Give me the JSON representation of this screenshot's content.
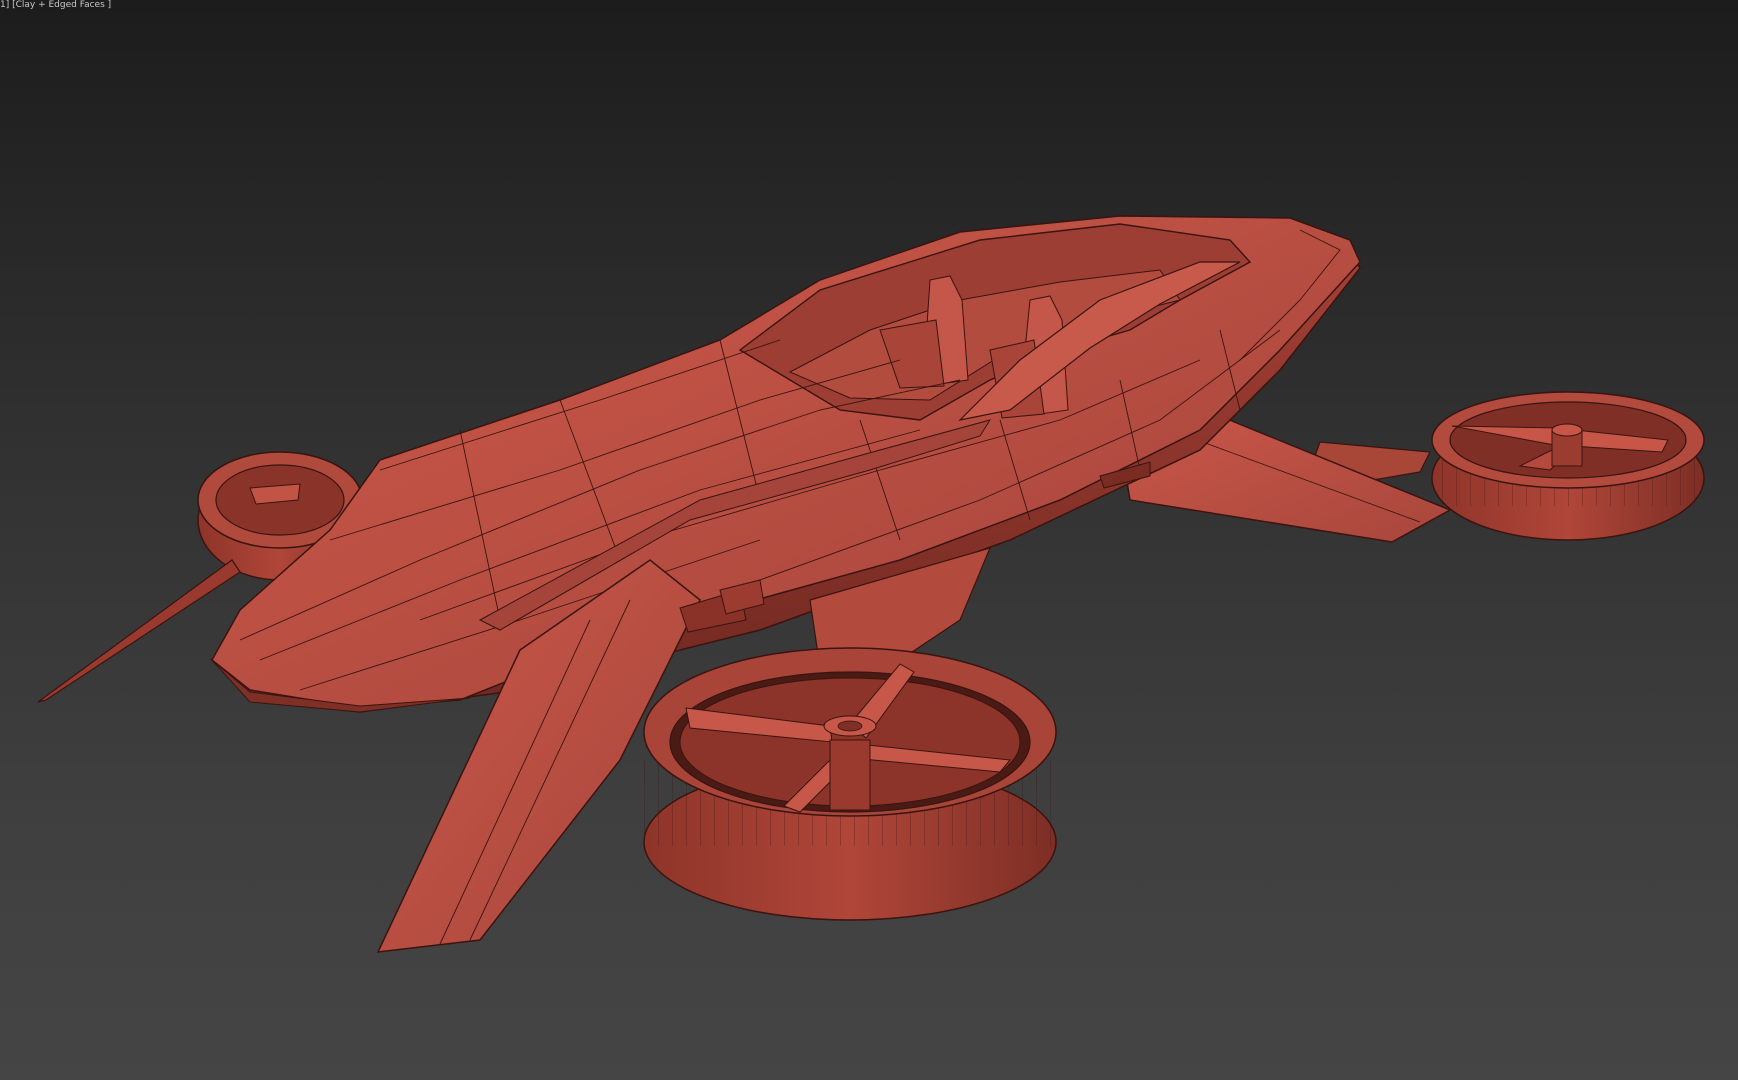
{
  "viewport": {
    "label": "1] [Clay + Edged Faces ]",
    "background_top": "#1c1c1c",
    "background_bottom": "#454545"
  },
  "model": {
    "color_base": "#b84b3e",
    "color_light": "#cf5a4a",
    "color_dark": "#7e2f26",
    "color_edges": "#3a1410"
  }
}
